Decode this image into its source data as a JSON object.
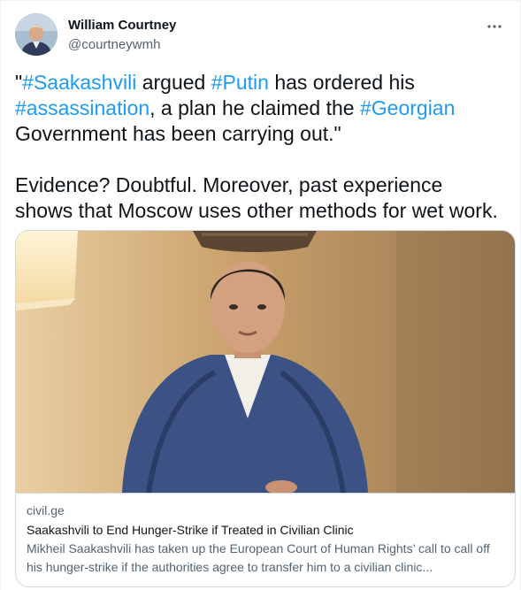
{
  "author": {
    "name": "William Courtney",
    "handle": "@courtneywmh",
    "avatar_icon": "avatar-photo"
  },
  "more_icon": "more-dots-icon",
  "tweet": {
    "line1": {
      "q": "\"",
      "tag1": "#Saakashvili",
      "t1": " argued ",
      "tag2": "#Putin",
      "t2": " has ordered his"
    },
    "line2": {
      "tag3": "#assassination",
      "t3": ", a plan he claimed the ",
      "tag4": "#Georgian"
    },
    "line3": "Government has been carrying out.\"",
    "line4": "Evidence?  Doubtful.  Moreover, past experience",
    "line5": "shows that Moscow uses other methods for wet work."
  },
  "card": {
    "domain": "civil.ge",
    "title": "Saakashvili to End Hunger-Strike if Treated in Civilian Clinic",
    "description": "Mikheil Saakashvili has taken up the European Court of Human Rights’ call to call off his hunger-strike if the authorities agree to transfer him to a civilian clinic..."
  },
  "colors": {
    "hashtag": "#1d9bf0",
    "text": "#0f1419",
    "secondary": "#536471",
    "border": "#cfd9de"
  }
}
